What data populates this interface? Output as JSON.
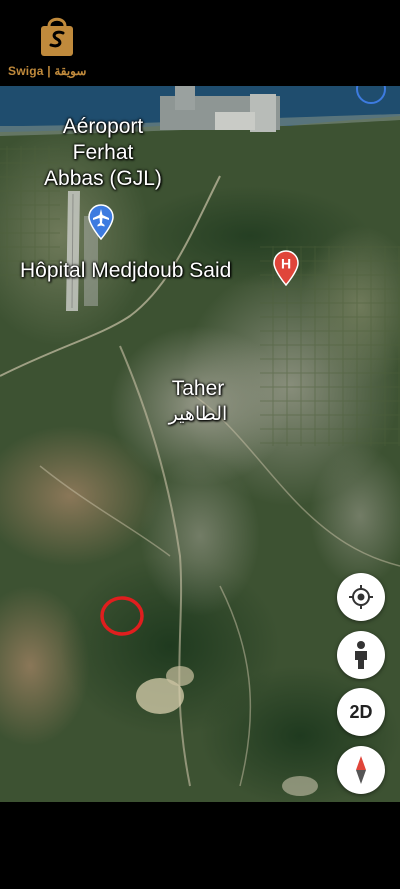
{
  "brand": {
    "name": "Swiga | سويقة",
    "color": "#c08a3c"
  },
  "map": {
    "labels": {
      "airport": [
        "Aéroport",
        "Ferhat",
        "Abbas (GJL)"
      ],
      "hospital": "Hôpital Medjdoub Said",
      "town_latin": "Taher",
      "town_arabic": "الطاهير"
    },
    "markers": {
      "airport_icon": "airplane-icon",
      "hospital_icon": "hospital-icon",
      "hospital_letter": "H",
      "highlight": "red-circle-marker"
    },
    "controls": {
      "locate_icon": "my-location-icon",
      "pegman_icon": "street-view-icon",
      "view_toggle": "2D",
      "compass_icon": "compass-icon"
    },
    "colors": {
      "airport_pin": "#3d7be0",
      "hospital_pin": "#e0453a",
      "highlight_circle": "#e01e1e",
      "sea": "#1f4d6e"
    }
  }
}
